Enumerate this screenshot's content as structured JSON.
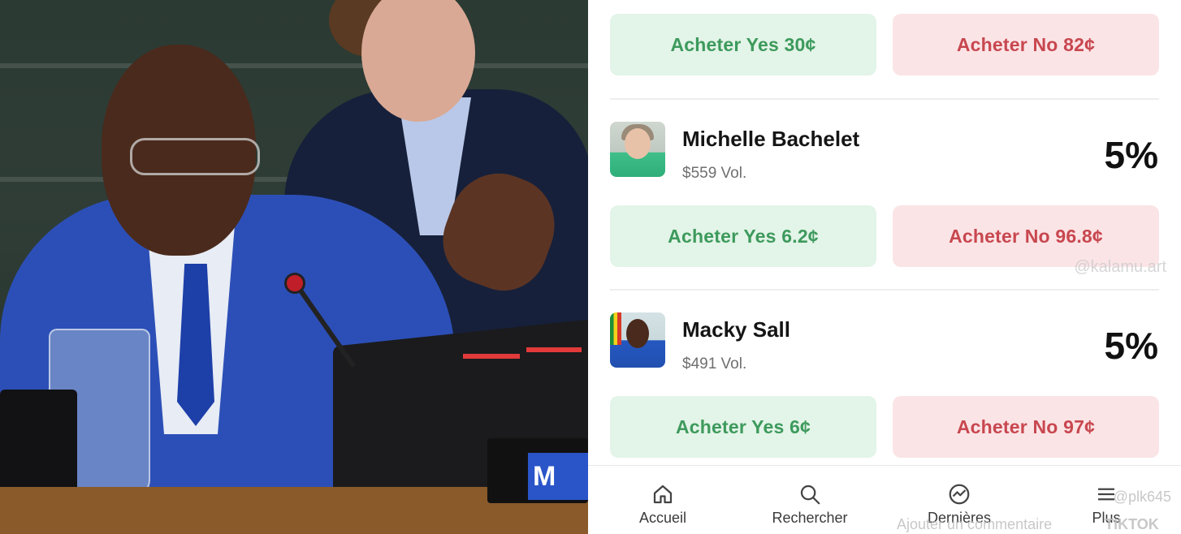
{
  "market": {
    "top_row": {
      "yes_label": "Acheter Yes 30¢",
      "no_label": "Acheter No 82¢"
    },
    "candidates": [
      {
        "name": "Michelle Bachelet",
        "volume": "$559 Vol.",
        "percent": "5%",
        "yes_label": "Acheter Yes 6.2¢",
        "no_label": "Acheter No 96.8¢"
      },
      {
        "name": "Macky Sall",
        "volume": "$491 Vol.",
        "percent": "5%",
        "yes_label": "Acheter Yes 6¢",
        "no_label": "Acheter No 97¢"
      }
    ],
    "watermark": "@kalamu.art"
  },
  "nav": {
    "items": [
      {
        "label": "Accueil",
        "icon": "home-icon"
      },
      {
        "label": "Rechercher",
        "icon": "search-icon"
      },
      {
        "label": "Dernières",
        "icon": "trending-icon"
      },
      {
        "label": "Plus",
        "icon": "menu-icon"
      }
    ],
    "overlay_text": "Ajouter un commentaire",
    "overlay_user": "@plk645",
    "overlay_brand": "TIKTOK"
  },
  "photo": {
    "nameplate_text": "M"
  },
  "colors": {
    "yes_bg": "#e3f4e8",
    "yes_text": "#3d9a5c",
    "no_bg": "#fbe4e6",
    "no_text": "#c8474f"
  }
}
